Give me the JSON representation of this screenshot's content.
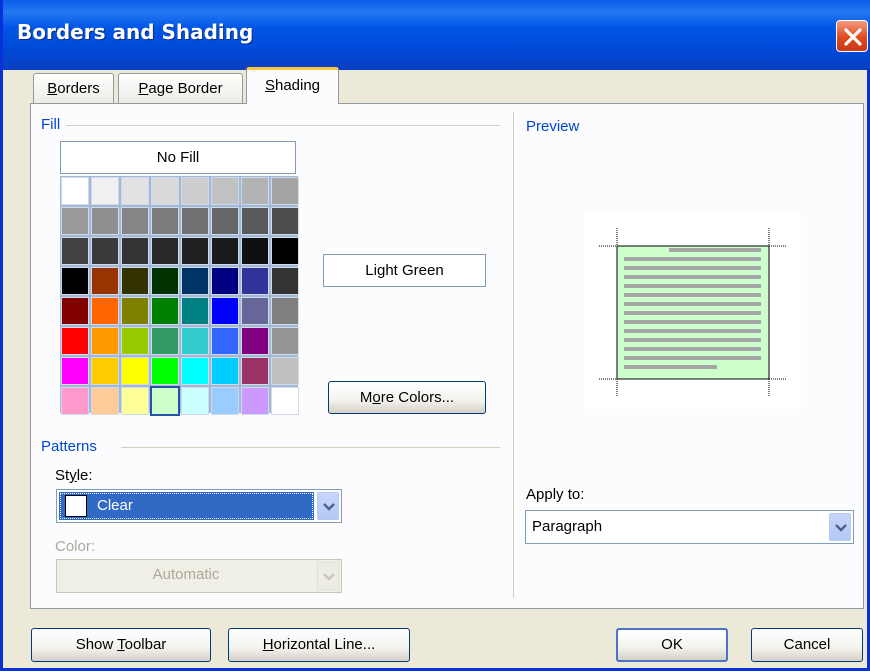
{
  "window": {
    "title": "Borders and Shading"
  },
  "tabs": [
    {
      "label": "Borders",
      "access_key": "B"
    },
    {
      "label": "Page Border",
      "access_key": "P"
    },
    {
      "label": "Shading",
      "access_key": "S",
      "active": true
    }
  ],
  "fill": {
    "group_label": "Fill",
    "no_fill_label": "No Fill",
    "selected_color_name": "Light Green",
    "more_colors_label": "More Colors...",
    "palette": [
      [
        "#ffffff",
        "#f1f1f1",
        "#e2e2e2",
        "#dadada",
        "#cdcdcd",
        "#c1c1c1",
        "#b3b3b3",
        "#a5a5a5"
      ],
      [
        "#999999",
        "#8f8f8f",
        "#868686",
        "#7b7b7b",
        "#717171",
        "#666666",
        "#595959",
        "#4d4d4d"
      ],
      [
        "#424242",
        "#3a3a3a",
        "#333333",
        "#292929",
        "#212121",
        "#1a1a1a",
        "#101010",
        "#000000"
      ],
      [
        "#000000",
        "#993300",
        "#333300",
        "#003300",
        "#003366",
        "#000080",
        "#333399",
        "#333333"
      ],
      [
        "#800000",
        "#ff6600",
        "#808000",
        "#008000",
        "#008080",
        "#0000ff",
        "#666699",
        "#808080"
      ],
      [
        "#ff0000",
        "#ff9900",
        "#99cc00",
        "#339966",
        "#33cccc",
        "#3366ff",
        "#800080",
        "#969696"
      ],
      [
        "#ff00ff",
        "#ffcc00",
        "#ffff00",
        "#00ff00",
        "#00ffff",
        "#00ccff",
        "#993366",
        "#c0c0c0"
      ],
      [
        "#ff99cc",
        "#ffcc99",
        "#ffff99",
        "#ccffcc",
        "#ccffff",
        "#99ccff",
        "#cc99ff",
        "#ffffff"
      ]
    ],
    "selected_row": 7,
    "selected_col": 3
  },
  "patterns": {
    "group_label": "Patterns",
    "style_label": "Style:",
    "style_value": "Clear",
    "color_label": "Color:",
    "color_value": "Automatic"
  },
  "preview": {
    "group_label": "Preview",
    "shading_color": "#ccffcc",
    "line_color": "#a6a6a6"
  },
  "apply_to": {
    "label": "Apply to:",
    "value": "Paragraph"
  },
  "footer": {
    "show_toolbar_label": "Show Toolbar",
    "horizontal_line_label": "Horizontal Line...",
    "ok_label": "OK",
    "cancel_label": "Cancel"
  },
  "colors": {
    "title_bar": "#0055e5",
    "accent_label": "#0046d5",
    "dialog_bg": "#ece9d8",
    "combo_selected_bg": "#316ac5"
  }
}
